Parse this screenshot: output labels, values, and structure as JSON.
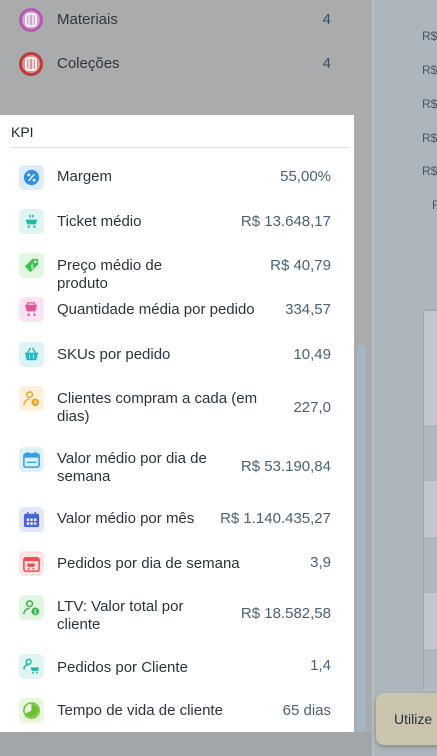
{
  "top_list": [
    {
      "label": "Materiais",
      "value": "4",
      "icon": "materials-icon",
      "color": "#b657b0"
    },
    {
      "label": "Coleções",
      "value": "4",
      "icon": "collections-icon",
      "color": "#c13b3b"
    }
  ],
  "kpi_title": "KPI",
  "kpis": [
    {
      "label": "Margem",
      "value": "55,00%",
      "icon": "percent-icon",
      "color": "#2f8fe0",
      "bg": "#dcecfb"
    },
    {
      "label": "Ticket médio",
      "value": "R$ 13.648,17",
      "icon": "cart-hand-icon",
      "color": "#26b5a6",
      "bg": "#dff5f2"
    },
    {
      "label": "Preço médio de produto",
      "value": "R$ 40,79",
      "icon": "price-tag-icon",
      "color": "#37c24a",
      "bg": "#e0f7e2"
    },
    {
      "label": "Quantidade média por pedido",
      "value": "334,57",
      "icon": "cart-bag-icon",
      "color": "#e0559c",
      "bg": "#fbe3ef"
    },
    {
      "label": "SKUs por pedido",
      "value": "10,49",
      "icon": "basket-icon",
      "color": "#22b8c0",
      "bg": "#dcf4f6"
    },
    {
      "label": "Clientes compram a cada (em dias)",
      "value": "227,0",
      "icon": "user-clock-icon",
      "color": "#f0a824",
      "bg": "#fdf1dc"
    },
    {
      "label": "Valor médio por dia de semana",
      "value": "R$ 53.190,84",
      "icon": "calendar-week-icon",
      "color": "#2ea4e0",
      "bg": "#dff0fa"
    },
    {
      "label": "Valor médio por mês",
      "value": "R$ 1.140.435,27",
      "icon": "calendar-month-icon",
      "color": "#4a66d6",
      "bg": "#e2e7fa"
    },
    {
      "label": "Pedidos por dia de semana",
      "value": "3,9",
      "icon": "calendar-cart-icon",
      "color": "#ea5050",
      "bg": "#fde4e4"
    },
    {
      "label": "LTV: Valor total por cliente",
      "value": "R$ 18.582,58",
      "icon": "user-money-icon",
      "color": "#37b24a",
      "bg": "#e1f5e3"
    },
    {
      "label": "Pedidos por Cliente",
      "value": "1,4",
      "icon": "user-cart-icon",
      "color": "#24b3a0",
      "bg": "#dff5f1"
    },
    {
      "label": "Tempo de vida de cliente",
      "value": "65 dias",
      "icon": "pie-time-icon",
      "color": "#6cbf2e",
      "bg": "#eaf6de"
    }
  ],
  "right_labels": [
    "R$",
    "R$",
    "R$",
    "R$",
    "R$",
    "R"
  ],
  "toast_text": "Utilize"
}
